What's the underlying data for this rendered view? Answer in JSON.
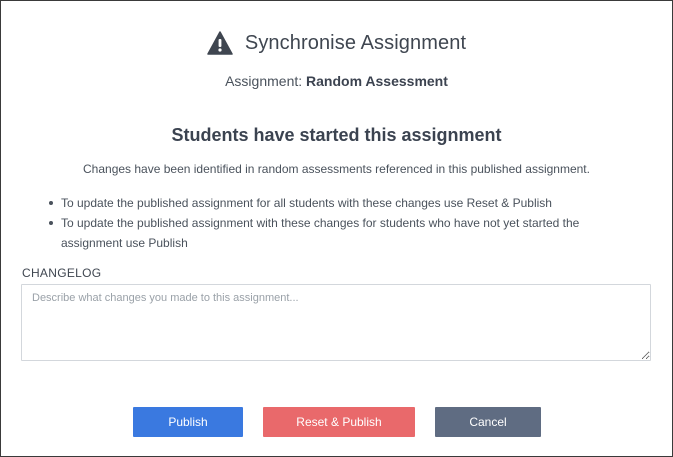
{
  "dialog": {
    "title": "Synchronise Assignment",
    "title_icon": "warning-icon",
    "assignment_label": "Assignment:",
    "assignment_name": "Random Assessment",
    "heading": "Students have started this assignment",
    "description": "Changes have been identified in random assessments referenced in this published assignment.",
    "bullets": [
      "To update the published assignment for all students with these changes use Reset & Publish",
      "To update the published assignment with these changes for students who have not yet started the assignment use Publish"
    ],
    "changelog": {
      "label": "CHANGELOG",
      "value": "",
      "placeholder": "Describe what changes you made to this assignment..."
    },
    "buttons": {
      "publish": "Publish",
      "reset_publish": "Reset & Publish",
      "cancel": "Cancel"
    }
  },
  "colors": {
    "publish": "#3a79e0",
    "reset_publish": "#e9696b",
    "cancel": "#5f6c82",
    "text": "#3c4652"
  }
}
